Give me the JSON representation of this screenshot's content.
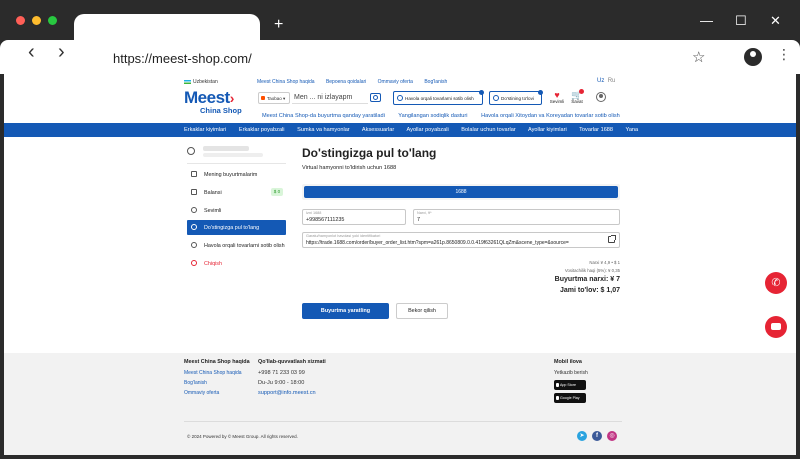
{
  "browser": {
    "url": "https://meest-shop.com/",
    "new_tab": "+",
    "back": "‹",
    "forward": "›",
    "star": "☆",
    "menu": "⋮",
    "minimize": "—",
    "maximize": "☐",
    "close": "✕"
  },
  "header": {
    "region": "Uzbekistan",
    "top_links": [
      "Meest China Shop haqida",
      "Bepoena qoidalari",
      "Ommaviy oferta",
      "Bog'lanish"
    ],
    "lang_uz": "Uz",
    "lang_ru": "Ru",
    "logo_main": "Meest",
    "logo_sub": "China Shop",
    "shop_select": "Taobao",
    "search_placeholder": "Men ... ni izlayapm",
    "link_buy_btn": "Havola orqali tovarlarni sotib olish",
    "friend_pay_btn": "Do'stining to'lovi",
    "favorites": "Sevimli",
    "cart": "Savat",
    "sub_links": [
      "Meest China Shop-da buyurtma qanday yaratiladi",
      "Yangilangan sodiqlik dasturi",
      "Havola orqali Xitoydan va Koreyadan tovarlar sotib olish"
    ]
  },
  "categories": [
    "Erkaklar kiyimlari",
    "Erkaklar poyabzali",
    "Sumka va hamyonlar",
    "Aksessuarlar",
    "Ayollar poyabzali",
    "Bolalar uchun tovarlar",
    "Ayollar kiyimlari",
    "Tovarlar 1688",
    "Yana"
  ],
  "sidebar": {
    "items": [
      {
        "label": "Mening buyurtmalarim"
      },
      {
        "label": "Balansi",
        "badge": "$ 0"
      },
      {
        "label": "Sevimli"
      },
      {
        "label": "Do'stingizga pul to'lang"
      },
      {
        "label": "Havola orqali tovarlarni sotib olish"
      },
      {
        "label": "Chiqish"
      }
    ]
  },
  "main": {
    "title": "Do'stingizga pul to'lang",
    "subtitle": "Virtual hamyonni to'ldirish uchun 1688",
    "tab": "1688",
    "phone_label": "Izni 1688",
    "phone_value": "+998567111235",
    "amount_label": "Narxi, ¥*",
    "amount_value": "7",
    "link_label": "Garatu/hamyonlot havolasi yoki identifikatori",
    "link_value": "https://trade.1688.com/order/buyer_order_list.htm?spm=a261p.8650809.0.0.419f63261QLqZm&scene_type=&source=",
    "summary_line1": "Narxi ¥ 4,9 • $ 1",
    "summary_line2": "Vositachilik haqi (5%): ¥ 0,35",
    "order_price": "Buyurtma narxi: ¥ 7",
    "total": "Jami to'lov: $ 1,07",
    "create_btn": "Buyurtma yaratling",
    "cancel_btn": "Bekor qilish"
  },
  "footer": {
    "about_head": "Meest China Shop haqida",
    "about_links": [
      "Meest China Shop haqida",
      "Bog'lanish",
      "Ommaviy oferta"
    ],
    "support_head": "Qo'llab-quvvatlash xizmati",
    "support_phone": "+998 71 233 03 99",
    "support_hours": "Du-Ju 9:00 - 18:00",
    "support_email": "support@info.meest.cn",
    "mobile_head": "Mobil ilova",
    "mobile_sub": "Yetkazib berish",
    "app_store": "App Store",
    "google_play": "Google Play",
    "copyright": "© 2024 Powered by © Meest Group. All rights reserved."
  },
  "colors": {
    "brand": "#1459b5",
    "accent": "#e62434"
  }
}
